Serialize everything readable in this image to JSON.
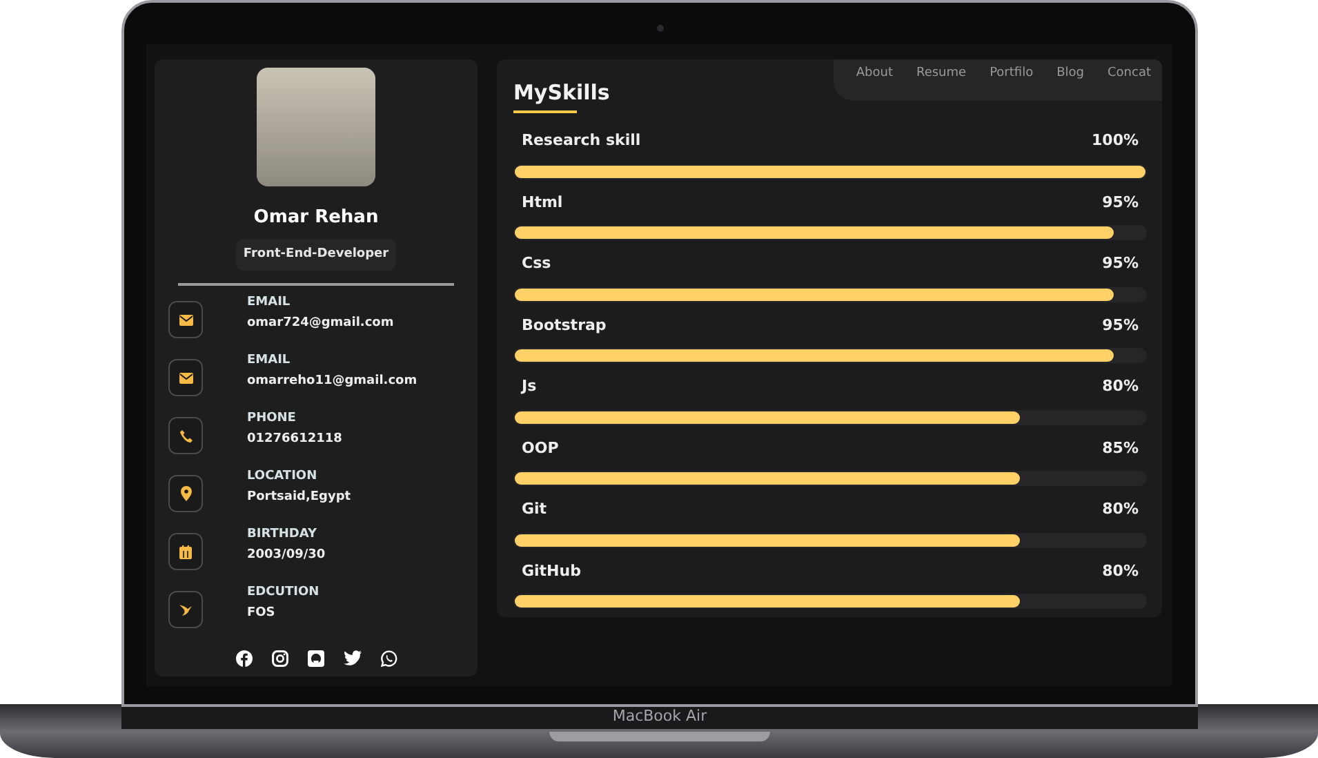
{
  "laptop": {
    "model_label": "MacBook Air"
  },
  "nav": [
    "About",
    "Resume",
    "Portfilo",
    "Blog",
    "Concat"
  ],
  "profile": {
    "name": "Omar Rehan",
    "role": "Front-End-Developer"
  },
  "contacts": [
    {
      "kind": "email",
      "label": "EMAIL",
      "value": "omar724@gmail.com"
    },
    {
      "kind": "email",
      "label": "EMAIL",
      "value": "omarreho11@gmail.com"
    },
    {
      "kind": "phone",
      "label": "PHONE",
      "value": "01276612118"
    },
    {
      "kind": "location",
      "label": "LOCATION",
      "value": "Portsaid,Egypt"
    },
    {
      "kind": "birthday",
      "label": "BIRTHDAY",
      "value": "2003/09/30"
    },
    {
      "kind": "education",
      "label": "EDCUTION",
      "value": "FOS"
    }
  ],
  "skills_title": "MySkills",
  "skills": [
    {
      "name": "Research skill",
      "reading": "100%",
      "level": 1.0
    },
    {
      "name": "Html",
      "reading": "95%",
      "level": 0.95
    },
    {
      "name": "Css",
      "reading": "95%",
      "level": 0.95
    },
    {
      "name": "Bootstrap",
      "reading": "95%",
      "level": 0.95
    },
    {
      "name": "Js",
      "reading": "80%",
      "level": 0.8
    },
    {
      "name": "OOP",
      "reading": "85%",
      "level": 0.8
    },
    {
      "name": "Git",
      "reading": "80%",
      "level": 0.8
    },
    {
      "name": "GitHub",
      "reading": "80%",
      "level": 0.8
    }
  ]
}
